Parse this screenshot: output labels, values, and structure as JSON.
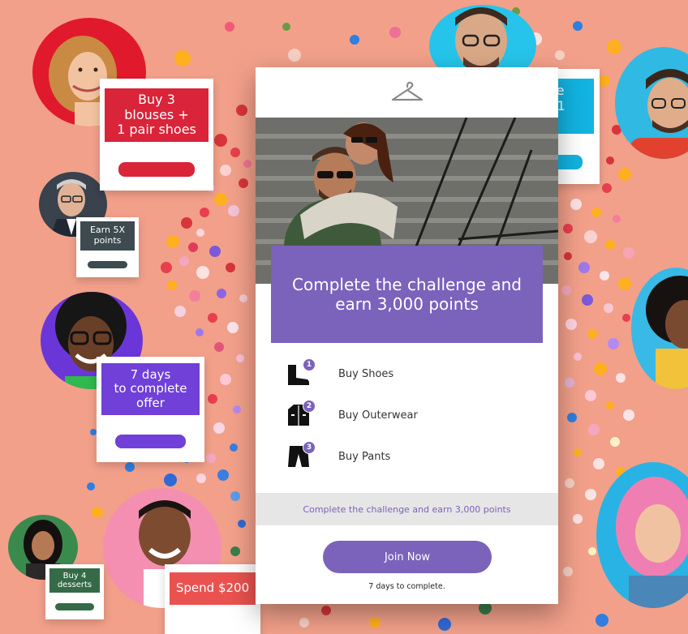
{
  "offers": {
    "blouses": "Buy 3\nblouses +\n1 pair shoes",
    "earn5x": "Earn 5X\npoints",
    "seven_days": "7 days\nto complete\noffer",
    "desserts": "Buy 4\ndesserts",
    "spend": "Spend $200",
    "partial_right": "rge\n+ 1\ne"
  },
  "main_card": {
    "logo_icon": "hanger-icon",
    "challenge_title": "Complete the challenge and earn 3,000 points",
    "tasks": [
      {
        "number": "1",
        "label": "Buy Shoes",
        "icon": "boot-icon"
      },
      {
        "number": "2",
        "label": "Buy Outerwear",
        "icon": "jacket-icon"
      },
      {
        "number": "3",
        "label": "Buy Pants",
        "icon": "pants-icon"
      }
    ],
    "info_text": "Complete the challenge and earn 3,000 points",
    "cta_label": "Join Now",
    "footnote": "7 days to complete."
  },
  "colors": {
    "background": "#f2a08a",
    "accent_purple": "#7b62bb",
    "offer_red": "#d9243a",
    "offer_slate": "#3d4a4f",
    "offer_violet": "#7040d8",
    "offer_green": "#356a47",
    "offer_coral": "#e9524f",
    "offer_cyan": "#12b3e0"
  }
}
